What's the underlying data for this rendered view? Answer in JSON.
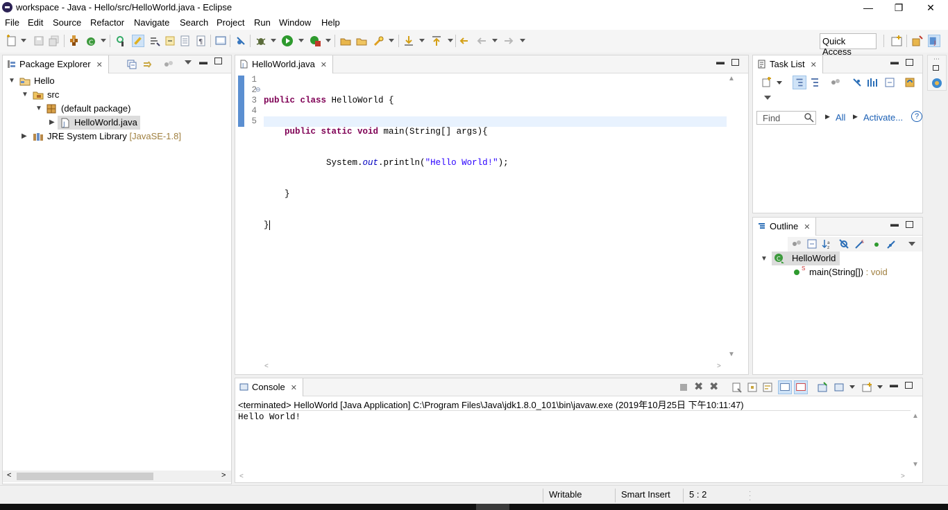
{
  "window": {
    "title": "workspace - Java - Hello/src/HelloWorld.java - Eclipse",
    "minimize": "—",
    "restore": "❐",
    "close": "✕"
  },
  "menu": {
    "file": "File",
    "edit": "Edit",
    "source": "Source",
    "refactor": "Refactor",
    "navigate": "Navigate",
    "search": "Search",
    "project": "Project",
    "run": "Run",
    "window": "Window",
    "help": "Help"
  },
  "toolbar": {
    "quick_access": "Quick Access"
  },
  "package_explorer": {
    "title": "Package Explorer",
    "tree": {
      "project": "Hello",
      "src": "src",
      "package": "(default package)",
      "file": "HelloWorld.java",
      "jre": "JRE System Library",
      "jre_version": "[JavaSE-1.8]"
    }
  },
  "editor": {
    "tab": "HelloWorld.java",
    "line_numbers": [
      "1",
      "2",
      "3",
      "4",
      "5"
    ],
    "code": {
      "l1_kw": "public class",
      "l1_rest": " HelloWorld {",
      "l2_kw": "public static void",
      "l2_rest": " main(String[] args){",
      "l3_a": "System.",
      "l3_field": "out",
      "l3_b": ".println(",
      "l3_str": "\"Hello World!\"",
      "l3_c": ");",
      "l4": "}",
      "l5": "}"
    }
  },
  "task_list": {
    "title": "Task List",
    "find_placeholder": "Find",
    "all": "All",
    "activate": "Activate...",
    "help": "?"
  },
  "outline": {
    "title": "Outline",
    "class_name": "HelloWorld",
    "method_static_marker": "S",
    "method": "main(String[])",
    "method_type": " : void"
  },
  "console": {
    "title": "Console",
    "status_line": "<terminated> HelloWorld [Java Application] C:\\Program Files\\Java\\jdk1.8.0_101\\bin\\javaw.exe (2019年10月25日 下午10:11:47)",
    "output": "Hello World!"
  },
  "statusbar": {
    "writable": "Writable",
    "insert_mode": "Smart Insert",
    "position": "5 : 2"
  },
  "colors": {
    "keyword": "#7f0055",
    "string": "#2a00ff",
    "field": "#0000c0",
    "current_line": "#e8f2fe",
    "selection": "#dcdcdc"
  }
}
